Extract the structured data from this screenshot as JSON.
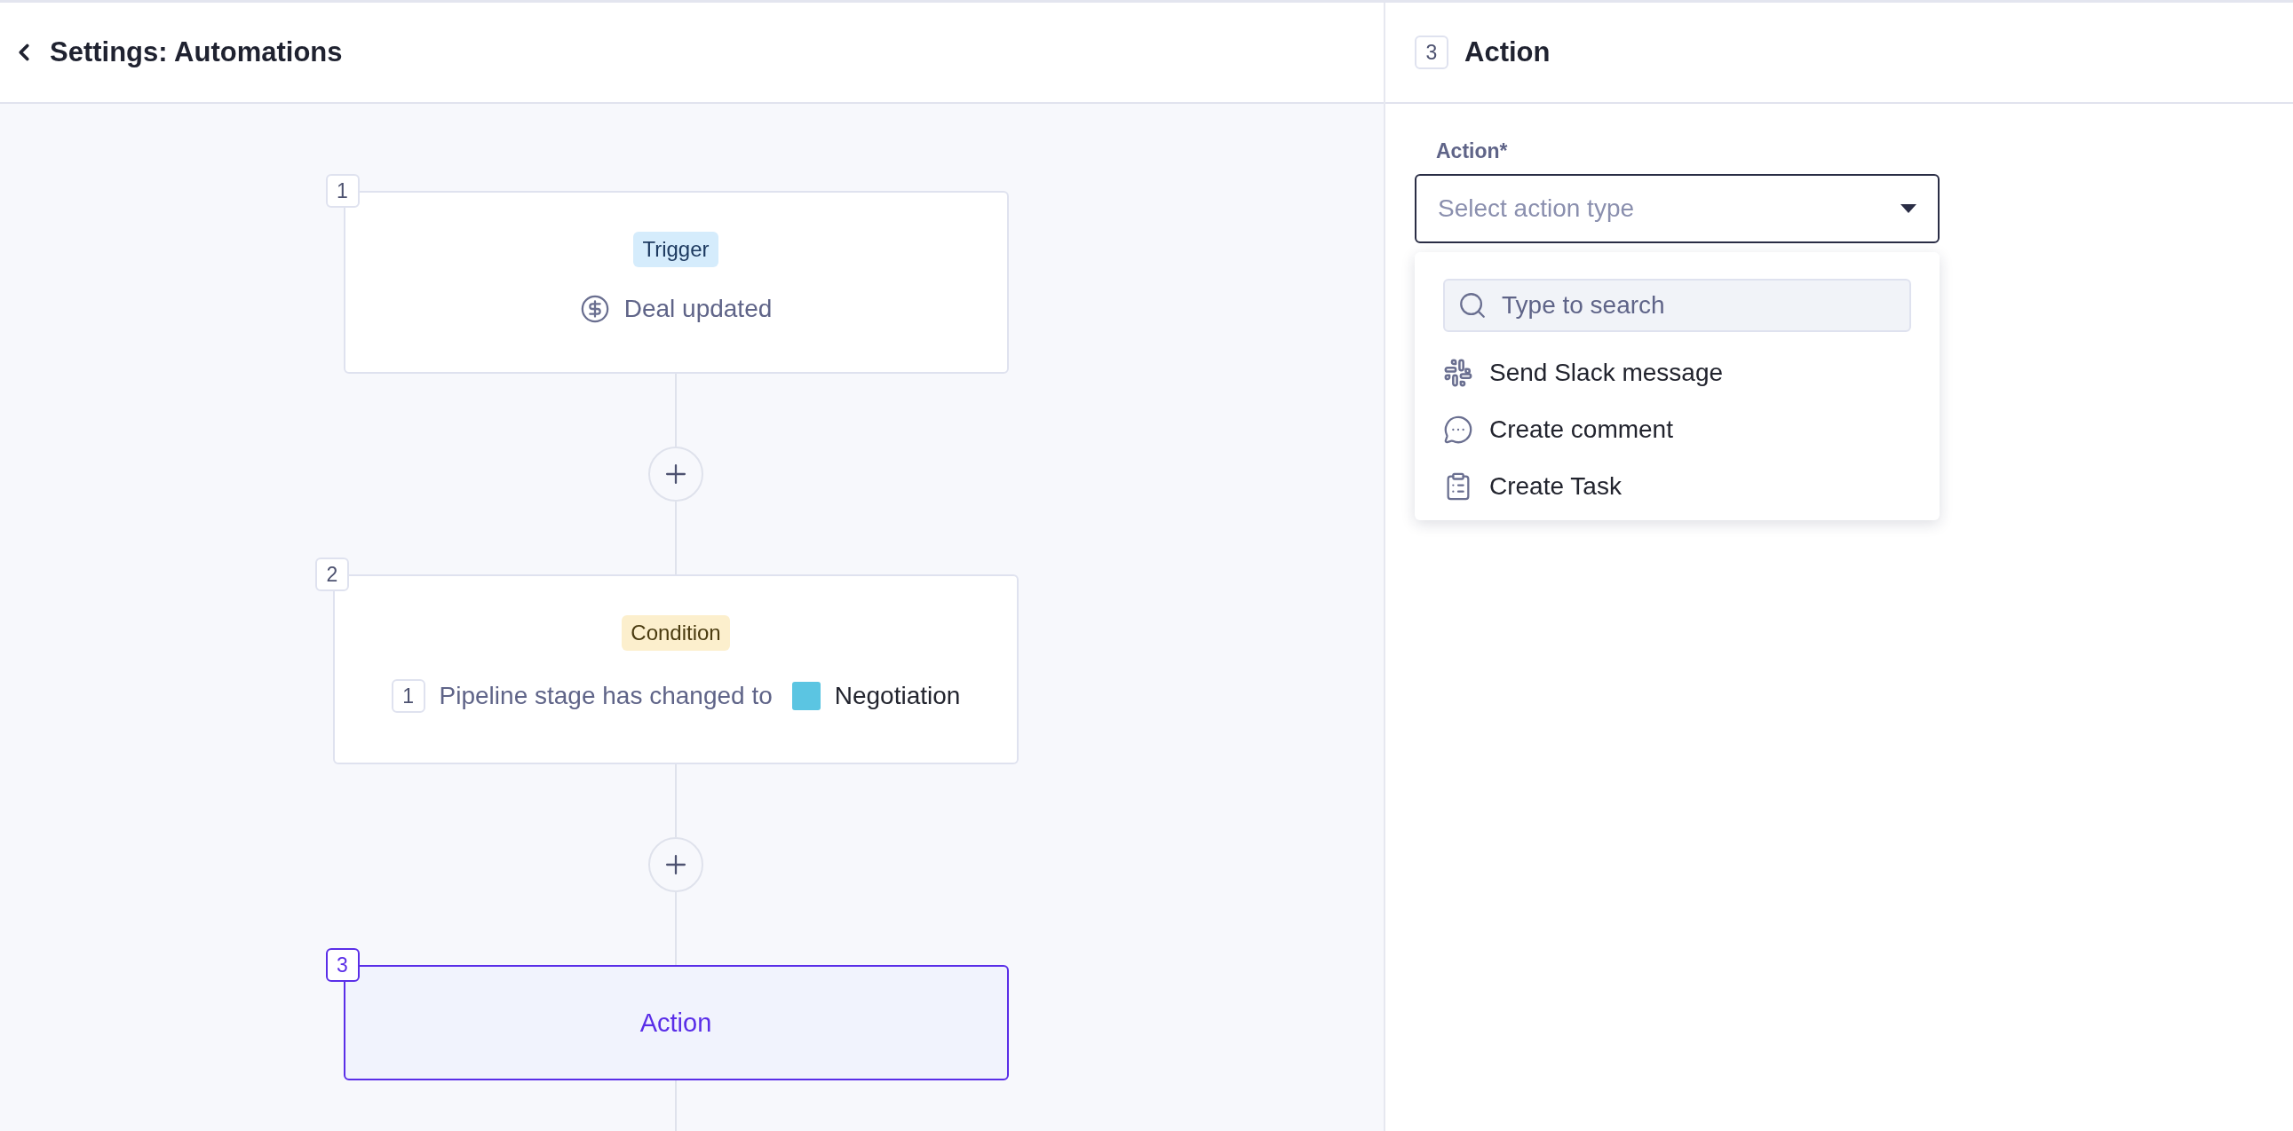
{
  "header": {
    "title": "Settings: Automations"
  },
  "steps": [
    {
      "number": "1",
      "kind": "trigger",
      "tag": "Trigger",
      "selected": false,
      "summary": "Deal updated"
    },
    {
      "number": "2",
      "kind": "condition",
      "tag": "Condition",
      "selected": false,
      "rules": [
        {
          "number": "1",
          "text": "Pipeline stage has changed to",
          "value": "Negotiation",
          "color": "#5bc5e2"
        }
      ]
    },
    {
      "number": "3",
      "kind": "action",
      "title": "Action",
      "selected": true
    }
  ],
  "panel": {
    "step_number": "3",
    "title": "Action",
    "field": {
      "label": "Action*",
      "placeholder": "Select action type",
      "expanded": true
    },
    "dropdown": {
      "search_placeholder": "Type to search",
      "options": [
        {
          "kind": "slack",
          "label": "Send Slack message"
        },
        {
          "kind": "comment",
          "label": "Create comment"
        },
        {
          "kind": "task",
          "label": "Create Task"
        }
      ]
    }
  }
}
